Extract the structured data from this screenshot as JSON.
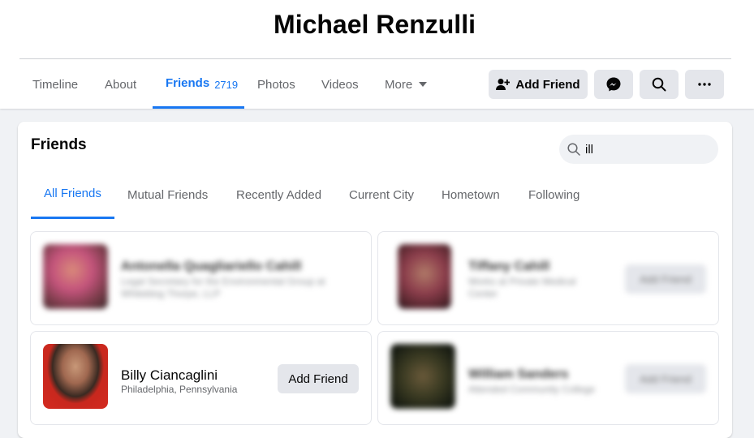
{
  "profile": {
    "name": "Michael Renzulli"
  },
  "nav": {
    "timeline": "Timeline",
    "about": "About",
    "friends": "Friends",
    "friends_count": "2719",
    "photos": "Photos",
    "videos": "Videos",
    "more": "More"
  },
  "actions": {
    "add_friend": "Add Friend"
  },
  "friends_section": {
    "title": "Friends",
    "search_value": "ill",
    "tabs": [
      "All Friends",
      "Mutual Friends",
      "Recently Added",
      "Current City",
      "Hometown",
      "Following"
    ]
  },
  "friends": [
    {
      "name": "Antonella Quagliariello Cahill",
      "subtitle": "Legal Secretary for the Environmental Group at Whiteblog Thorpe, LLP",
      "button": ""
    },
    {
      "name": "Tiffany Cahill",
      "subtitle": "Works at Private Medical Center",
      "button": "Add Friend"
    },
    {
      "name": "Billy Ciancaglini",
      "subtitle": "Philadelphia, Pennsylvania",
      "button": "Add Friend"
    },
    {
      "name": "William Sanders",
      "subtitle": "Attended Community College",
      "button": "Add Friend"
    }
  ],
  "colors": {
    "accent": "#1877f2",
    "button_bg": "#e4e6eb",
    "muted_text": "#65676b"
  }
}
